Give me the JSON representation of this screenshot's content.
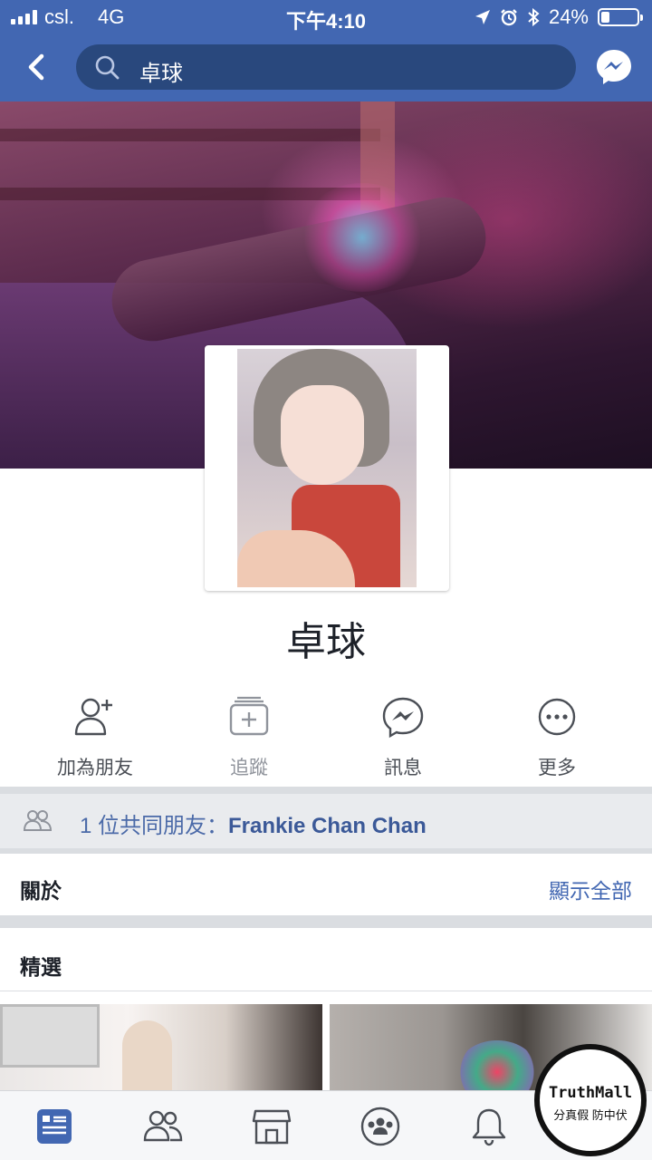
{
  "status_bar": {
    "carrier": "csl.",
    "network": "4G",
    "time": "下午4:10",
    "battery": "24%",
    "battery_level": 0.24
  },
  "search": {
    "query": "卓球"
  },
  "profile": {
    "name": "卓球"
  },
  "actions": [
    {
      "label": "加為朋友",
      "icon": "add-friend-icon"
    },
    {
      "label": "追蹤",
      "icon": "follow-icon"
    },
    {
      "label": "訊息",
      "icon": "messenger-icon"
    },
    {
      "label": "更多",
      "icon": "more-icon"
    }
  ],
  "mutual_friends": {
    "prefix": "1 位共同朋友：",
    "names": "Frankie Chan Chan"
  },
  "about": {
    "title": "關於",
    "link": "顯示全部"
  },
  "featured": {
    "title": "精選"
  },
  "tab_bar": [
    "news-feed-icon",
    "friends-icon",
    "marketplace-icon",
    "groups-icon",
    "notifications-icon",
    "menu-icon"
  ],
  "watermark": {
    "line1": "TruthMall",
    "line2": "分真假 防中伏"
  },
  "colors": {
    "brand_blue": "#4267b2",
    "search_bg": "#29487d",
    "link_blue": "#4267b2"
  }
}
